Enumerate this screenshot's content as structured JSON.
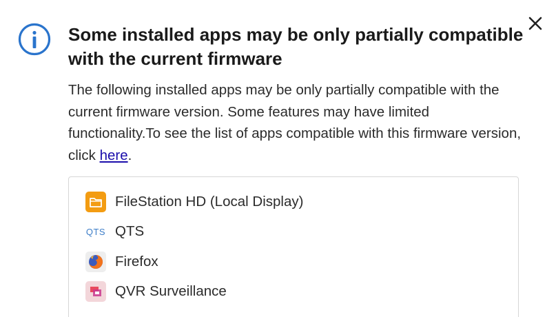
{
  "dialog": {
    "title": "Some installed apps may be only partially compatible with the current firmware",
    "message_before_link": "The following installed apps may be only partially compatible with the current firmware version. Some features may have limited functionality.To see the list of apps compatible with this firmware version, click ",
    "link_text": "here",
    "message_after_link": ".",
    "info_icon": "info-circle-icon",
    "close_icon": "close-icon",
    "accent_color": "#2a74cc"
  },
  "apps": [
    {
      "label": "FileStation HD (Local Display)",
      "icon": "filestation-folder-icon",
      "icon_color": "#f39c12"
    },
    {
      "label": "QTS",
      "icon": "qts-logo-icon",
      "icon_text": "QTS",
      "icon_color": "#3d7ec8"
    },
    {
      "label": "Firefox",
      "icon": "firefox-icon",
      "icon_color": "#e66000"
    },
    {
      "label": "QVR Surveillance",
      "icon": "qvr-surveillance-icon",
      "icon_color": "#e84a5f"
    }
  ]
}
